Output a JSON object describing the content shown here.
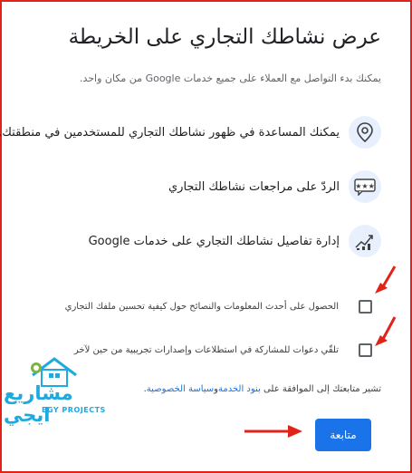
{
  "dialog": {
    "title": "عرض نشاطك التجاري على الخريطة",
    "subtitle": "يمكنك بدء التواصل مع العملاء على جميع خدمات Google من مكان واحد."
  },
  "features": [
    {
      "icon": "location-pin-icon",
      "text": "يمكنك المساعدة في ظهور نشاطك التجاري للمستخدمين في منطقتك."
    },
    {
      "icon": "review-chat-icon",
      "text": "الردّ على مراجعات نشاطك التجاري"
    },
    {
      "icon": "growth-chart-icon",
      "text": "إدارة تفاصيل نشاطك التجاري على خدمات Google"
    }
  ],
  "checkboxes": [
    {
      "label": "الحصول على أحدث المعلومات والنصائح حول كيفية تحسين ملفك التجاري",
      "checked": false
    },
    {
      "label": "تلقّي دعوات للمشاركة في استطلاعات وإصدارات تجريبية من حين لآخر",
      "checked": false
    }
  ],
  "terms": {
    "prefix": "تشير متابعتك إلى الموافقة على",
    "terms_link": "بنود الخدمة",
    "conjunction": "و",
    "privacy_link": "سياسة الخصوصية",
    "suffix": "."
  },
  "continue_button": "متابعة",
  "watermark": {
    "name": "مشاريع ايجي",
    "sub": "EGY PROJECTS"
  },
  "colors": {
    "accent": "#1a73e8",
    "icon_bg": "#e8f0fe",
    "annotation": "#e2231a"
  }
}
